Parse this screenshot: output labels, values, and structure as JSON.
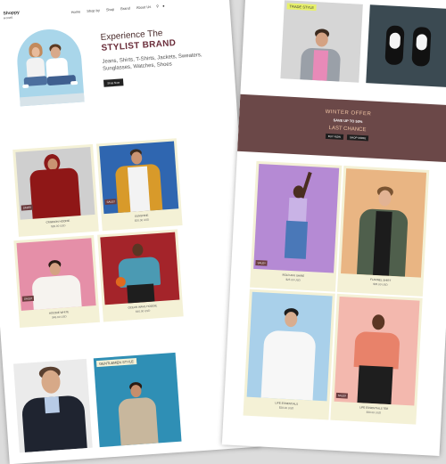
{
  "brand": {
    "logo": "Shoppy",
    "logo_sub": "HOME"
  },
  "nav": {
    "items": [
      "Home",
      "Shop by",
      "Shop",
      "Brand",
      "About Us"
    ],
    "icons": [
      "search-icon",
      "user-icon"
    ]
  },
  "hero": {
    "headline_1": "Experience The",
    "headline_2": "STYLIST BRAND",
    "subtitle": "Jeans, Shirts, T-Shirts, Jackets, Sweaters, Sunglasses, Watches, Shoes",
    "button": "Shop Now"
  },
  "left_products": [
    {
      "name": "CRIMSON HOODIE",
      "price": "$35.00 USD",
      "badge": "SALE!!"
    },
    {
      "name": "SUNSHINE",
      "price": "$20.00 USD",
      "badge": "SALE!!"
    },
    {
      "name": "HOODIE WHITE",
      "price": "$45.00 USD",
      "badge": "SALE!!"
    },
    {
      "name": "OCEAN WAVE HOODIE",
      "price": "$40.00 USD",
      "badge": ""
    }
  ],
  "left_bottom": {
    "tag": "GENTLEMEN STYLE"
  },
  "right_top": {
    "tag": "TRADE STYLE"
  },
  "banner": {
    "line1": "WINTER OFFER",
    "line2": "SAVE UP TO 50%",
    "line3": "LAST CHANCE",
    "btn1": "BUY NOW",
    "btn2": "SHOP MORE"
  },
  "right_products": [
    {
      "name": "BOLD AFK SHIRE",
      "price": "$25.00 USD",
      "badge": "SALE!!"
    },
    {
      "name": "FLANNEL SHIRT",
      "price": "$35.00 USD",
      "badge": ""
    },
    {
      "name": "LIFE ESSENTIALS",
      "price": "$28.00 USD",
      "badge": ""
    },
    {
      "name": "LIFE ESSENTIALS TEE",
      "price": "$30.00 USD",
      "badge": "SALE!!"
    }
  ],
  "colors": {
    "accent": "#6b4848",
    "card_bg": "#f4f1d6",
    "sky": "#a9d6ea"
  }
}
